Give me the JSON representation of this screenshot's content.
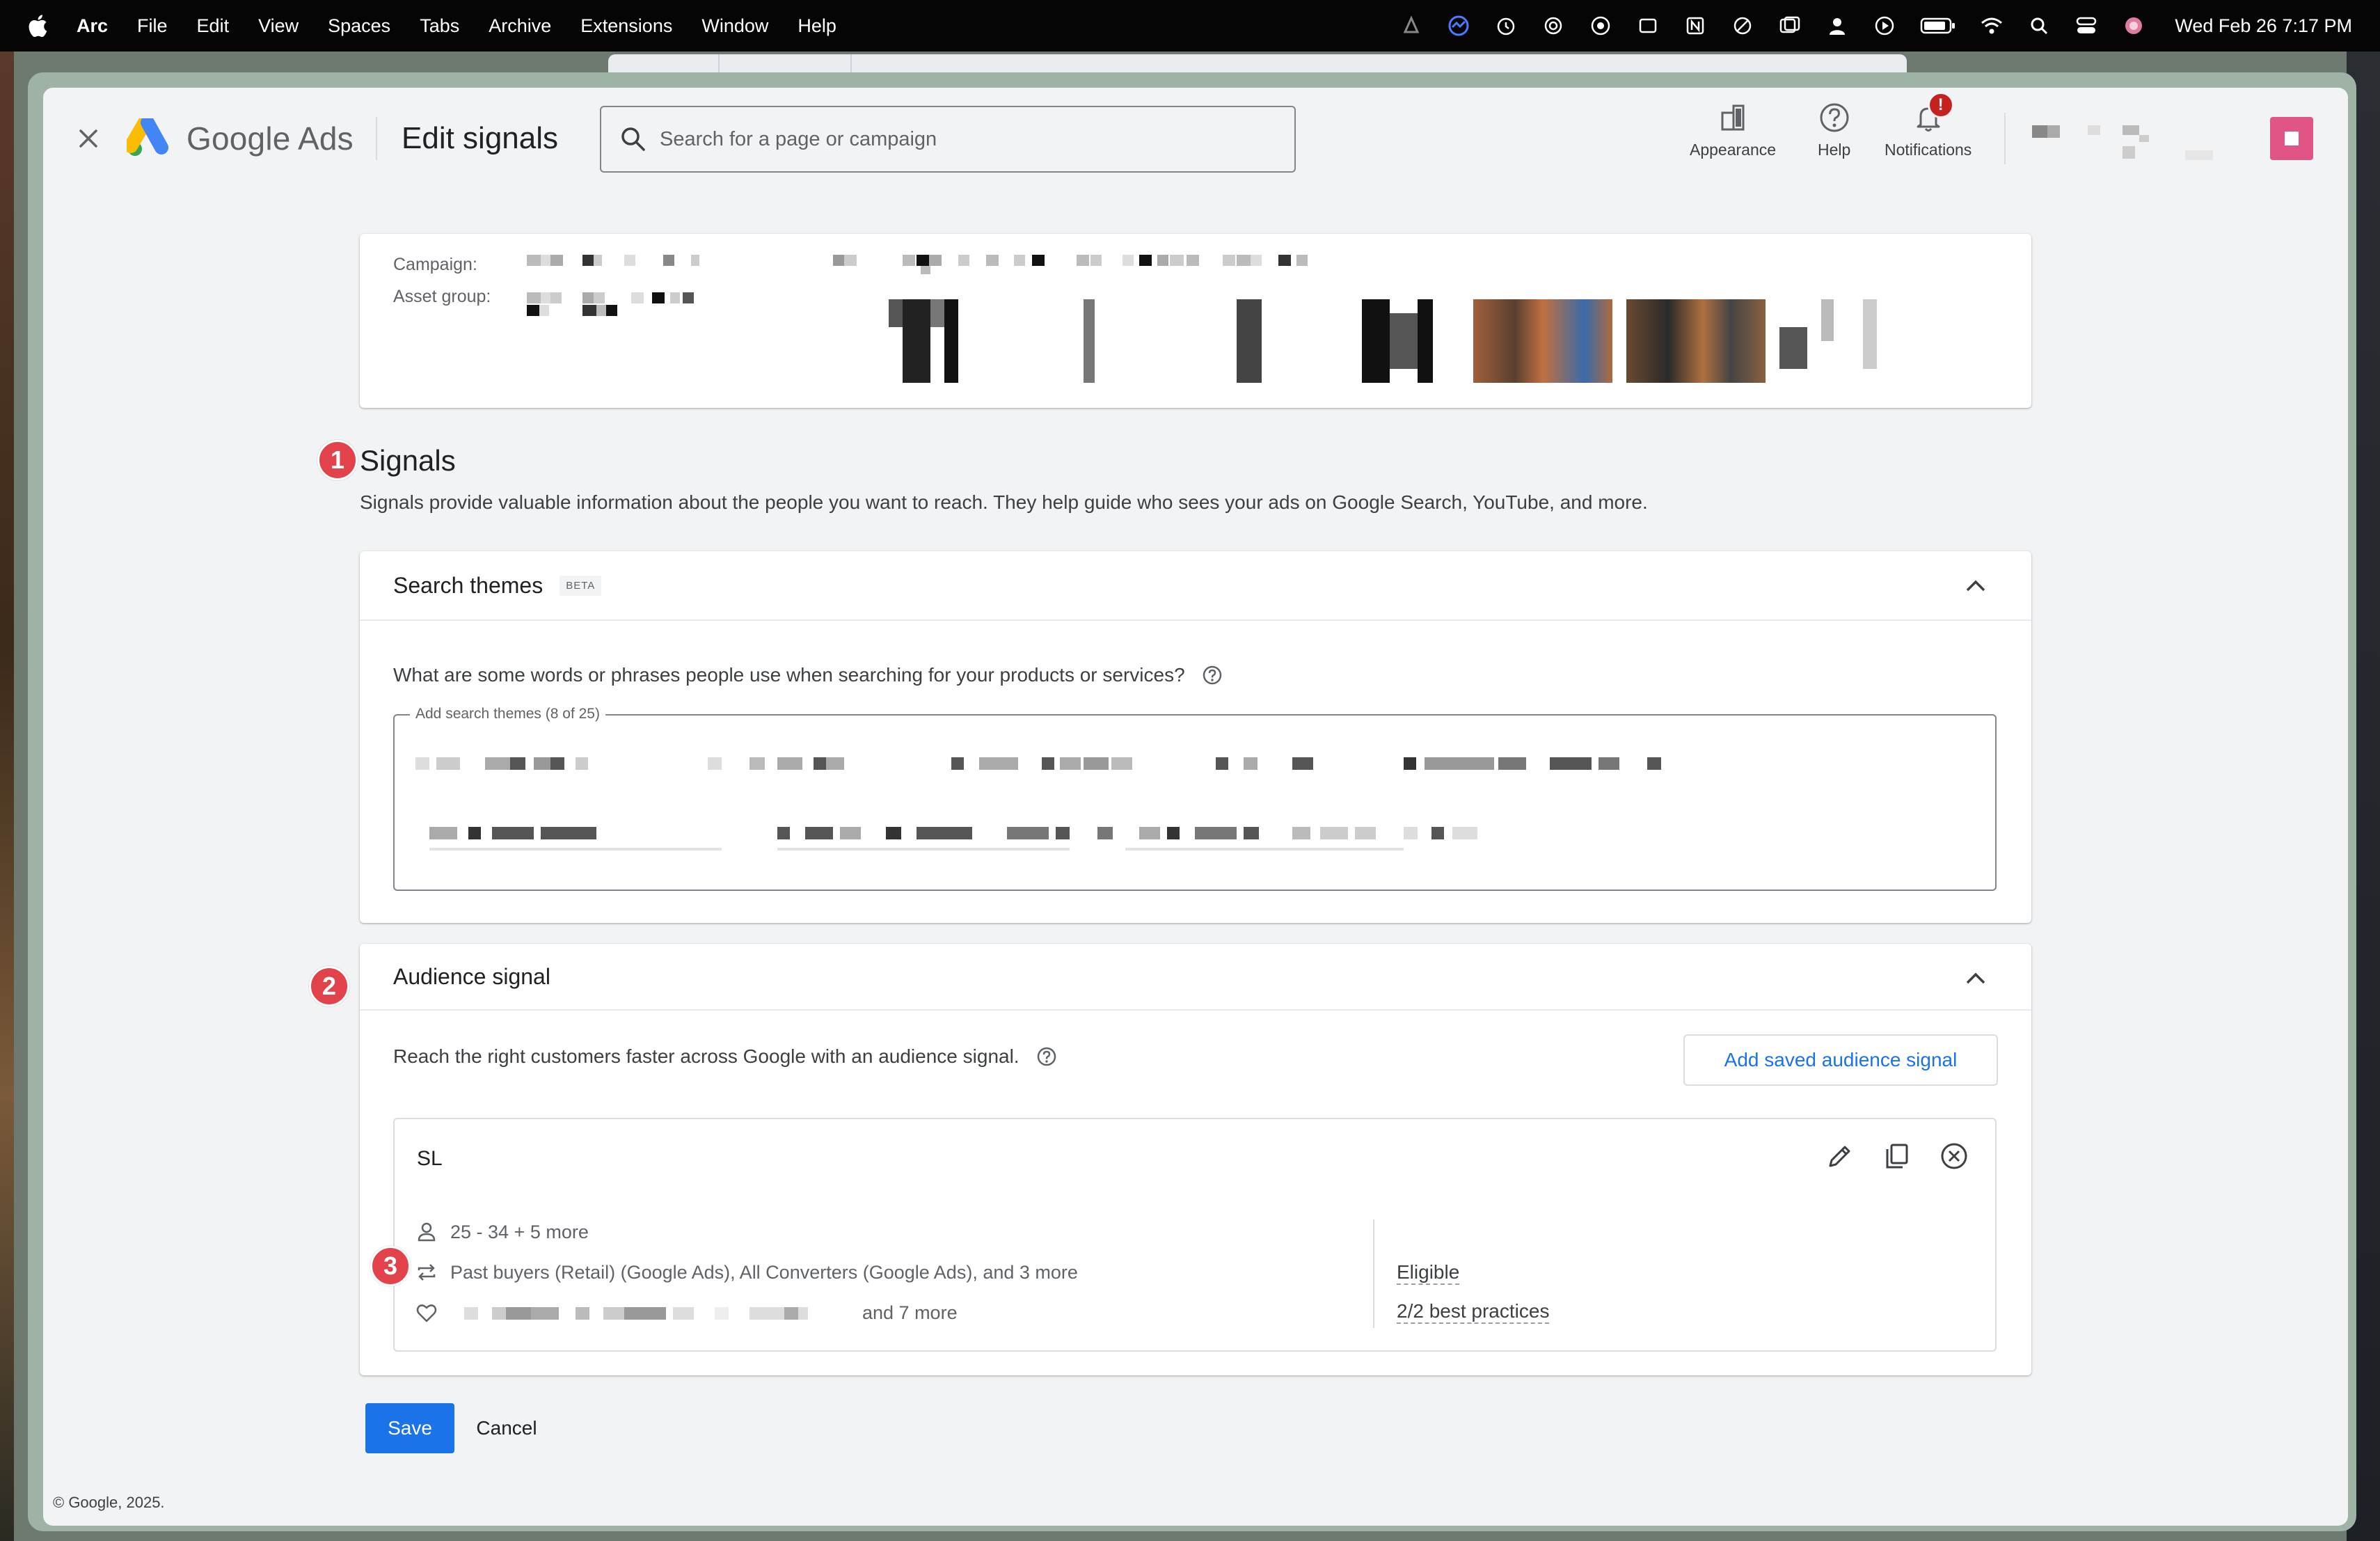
{
  "menubar": {
    "app_name": "Arc",
    "items": [
      "File",
      "Edit",
      "View",
      "Spaces",
      "Tabs",
      "Archive",
      "Extensions",
      "Window",
      "Help"
    ],
    "clock": "Wed Feb 26  7:17 PM"
  },
  "header": {
    "brand": "Google Ads",
    "page_title": "Edit signals",
    "search_placeholder": "Search for a page or campaign",
    "tools": [
      {
        "label": "Appearance",
        "icon": "appearance-icon"
      },
      {
        "label": "Help",
        "icon": "help-icon"
      },
      {
        "label": "Notifications",
        "icon": "bell-icon",
        "badge": "!"
      }
    ],
    "avatar_color": "#e05585"
  },
  "info": {
    "campaign_label": "Campaign:",
    "asset_group_label": "Asset group:"
  },
  "signals": {
    "marker": "1",
    "title": "Signals",
    "description": "Signals provide valuable information about the people you want to reach. They help guide who sees your ads on Google Search, YouTube, and more."
  },
  "search_themes": {
    "title": "Search themes",
    "badge": "BETA",
    "question": "What are some words or phrases people use when searching for your products or services?",
    "field_label": "Add search themes (8 of 25)"
  },
  "audience": {
    "marker": "2",
    "title": "Audience signal",
    "description": "Reach the right customers faster across Google with an audience signal.",
    "add_button": "Add saved audience signal",
    "signal": {
      "name": "SL",
      "demographics": "25 - 34 + 5 more",
      "marker": "3",
      "your_data": "Past buyers (Retail) (Google Ads), All Converters (Google Ads), and 3 more",
      "interests_suffix": "and 7 more",
      "status": "Eligible",
      "best_practices": "2/2 best practices"
    }
  },
  "actions": {
    "save": "Save",
    "cancel": "Cancel"
  },
  "footer": "© Google, 2025.",
  "colors": {
    "primary": "#1a73e8",
    "marker": "#e2434b",
    "badge": "#c5221f"
  }
}
